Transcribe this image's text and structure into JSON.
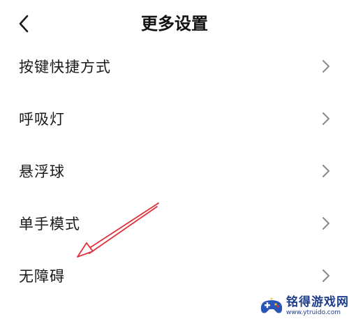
{
  "header": {
    "title": "更多设置",
    "back_icon": "chevron-left-icon"
  },
  "settings": {
    "items": [
      {
        "label": "按键快捷方式",
        "icon": "chevron-right-icon"
      },
      {
        "label": "呼吸灯",
        "icon": "chevron-right-icon"
      },
      {
        "label": "悬浮球",
        "icon": "chevron-right-icon"
      },
      {
        "label": "单手模式",
        "icon": "chevron-right-icon"
      },
      {
        "label": "无障碍",
        "icon": "chevron-right-icon"
      }
    ]
  },
  "annotation": {
    "color": "#e0303a"
  },
  "watermark": {
    "name": "铭得游戏网",
    "url": "www.ytruido.com",
    "color": "#1f3f8c"
  }
}
